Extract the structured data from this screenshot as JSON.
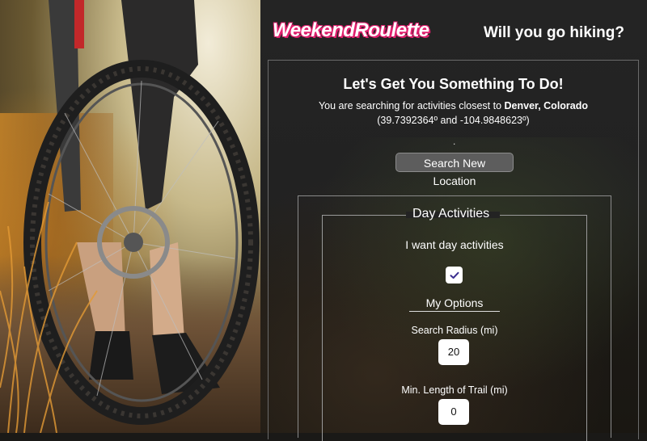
{
  "header": {
    "brand": "WeekendRoulette",
    "tagline": "Will you go hiking?"
  },
  "intro": {
    "heading": "Let's Get You Something To Do!",
    "location_prefix": "You are searching for activities closest to ",
    "location_name": "Denver, Colorado",
    "coordinates": "(39.7392364º and -104.9848623º)",
    "dot": ".",
    "search_button_label": "Search New Location"
  },
  "day_activities": {
    "legend": "Day Activities",
    "toggle_label": "I want day activities",
    "checked": true,
    "options_heading": "My Options",
    "radius_label": "Search Radius (mi)",
    "radius_value": "20",
    "trail_label": "Min. Length of Trail (mi)",
    "trail_value": "0"
  },
  "colors": {
    "brand_outline": "#e0206e",
    "check_color": "#3b2f8f",
    "button_bg": "#5d5d5d"
  },
  "icons": {
    "checkmark": "checkmark-icon"
  }
}
